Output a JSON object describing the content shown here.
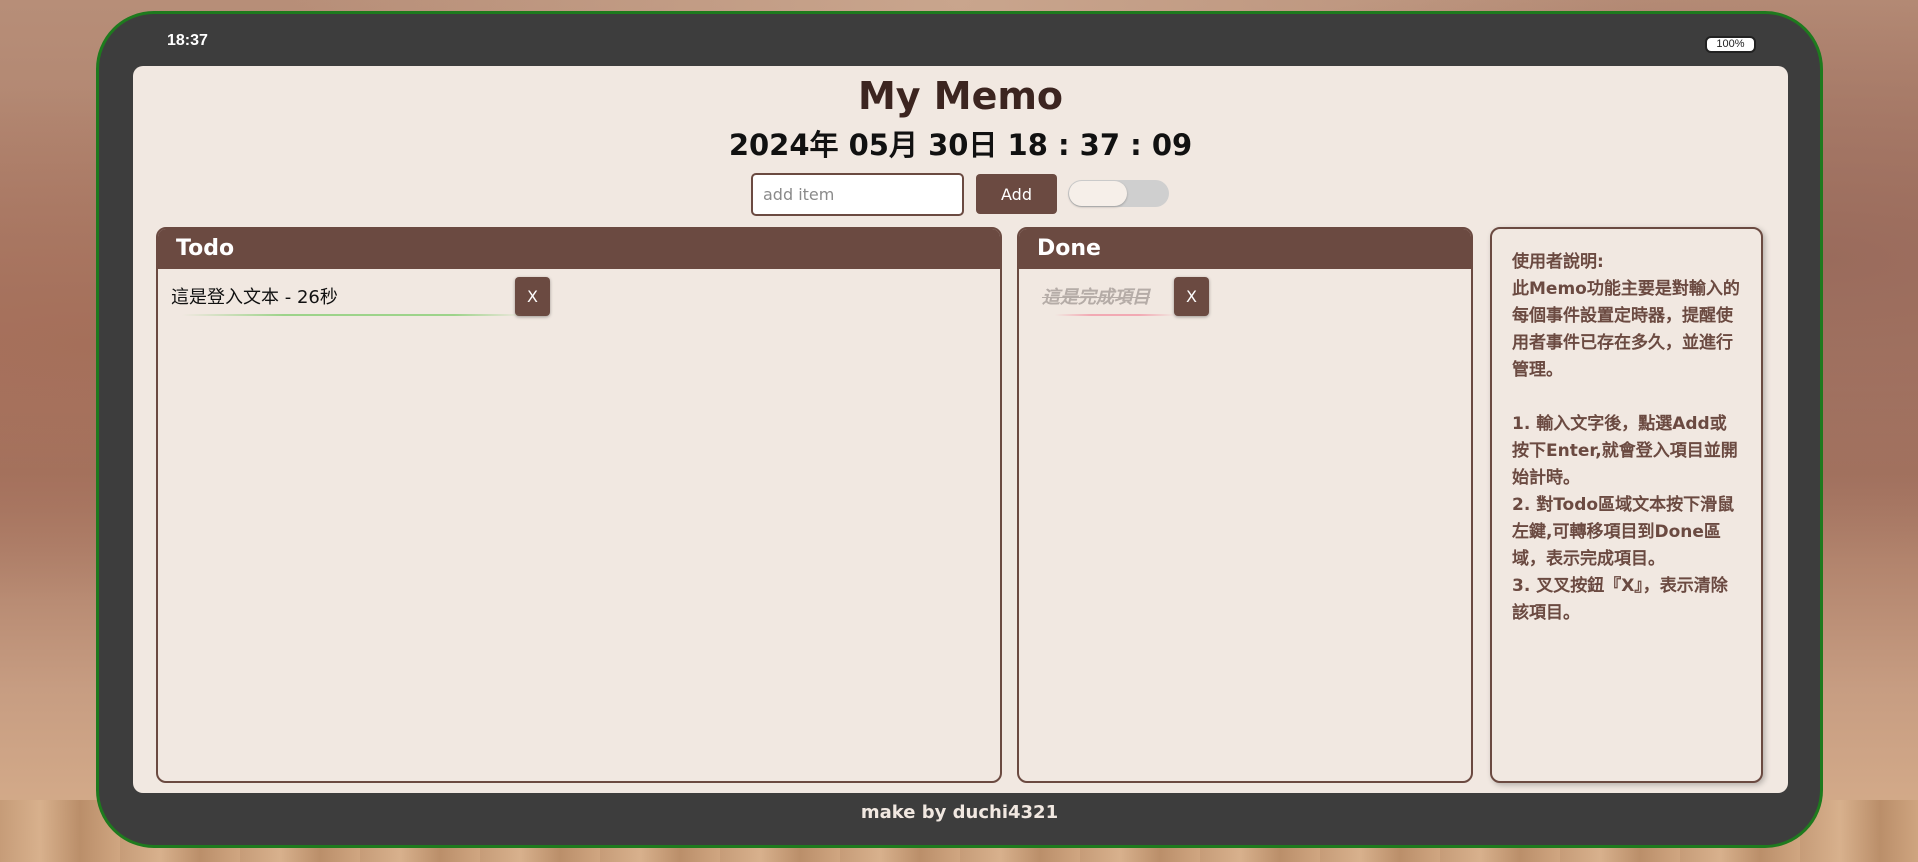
{
  "status": {
    "time": "18:37",
    "battery": "100%"
  },
  "app": {
    "title": "My Memo",
    "clock": "2024年 05月 30日 18 : 37 : 09"
  },
  "add_bar": {
    "placeholder": "add item",
    "value": "",
    "add_label": "Add",
    "toggle_on": false
  },
  "todo": {
    "header": "Todo",
    "items": [
      {
        "text": "這是登入文本 - 26秒",
        "delete_label": "X"
      }
    ]
  },
  "done": {
    "header": "Done",
    "items": [
      {
        "text": "這是完成項目",
        "delete_label": "X"
      }
    ]
  },
  "help": {
    "text": "使用者說明:\n此Memo功能主要是對輸入的每個事件設置定時器，提醒使用者事件已存在多久，並進行管理。\n\n1. 輸入文字後，點選Add或按下Enter,就會登入項目並開始計時。\n2. 對Todo區域文本按下滑鼠左鍵,可轉移項目到Done區域，表示完成項目。\n3. 叉叉按鈕『X』，表示清除該項目。"
  },
  "footer": {
    "text": "make by duchi4321"
  },
  "colors": {
    "accent": "#6b4a41",
    "screen_bg": "#f1e8e1",
    "bezel": "#3d3d3d",
    "bezel_border": "#1e7a1e"
  }
}
